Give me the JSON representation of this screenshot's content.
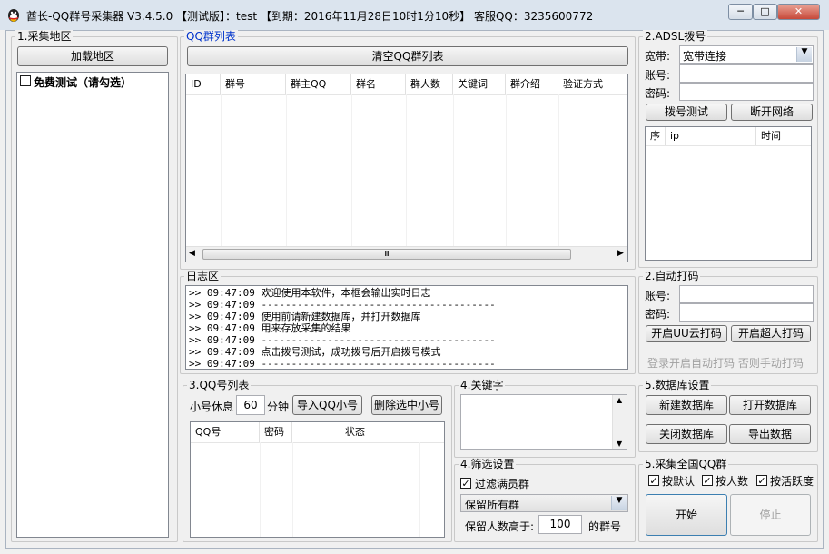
{
  "window": {
    "title": "酋长-QQ群号采集器 V3.4.5.0 【测试版】：test 【到期：2016年11月28日10时1分10秒】 客服QQ：3235600772",
    "min_label": "─",
    "max_label": "□",
    "close_label": "✕"
  },
  "region": {
    "group_label": "1.采集地区",
    "load_button": "加载地区",
    "items": [
      {
        "label": "免费测试（请勾选）",
        "checked": false
      }
    ]
  },
  "qq_groups": {
    "group_label": "QQ群列表",
    "clear_button": "清空QQ群列表",
    "columns": [
      "ID",
      "群号",
      "群主QQ",
      "群名",
      "群人数",
      "关键词",
      "群介绍",
      "验证方式"
    ],
    "scroll_thumb": "Ⅲ"
  },
  "adsl": {
    "group_label": "2.ADSL拨号",
    "broadband_label": "宽带:",
    "broadband_value": "宽带连接",
    "account_label": "账号:",
    "password_label": "密码:",
    "test_button": "拨号测试",
    "disconnect_button": "断开网络",
    "columns": [
      "序",
      "ip",
      "时间"
    ]
  },
  "log": {
    "group_label": "日志区",
    "lines": [
      ">> 09:47:09  欢迎使用本软件，本框会输出实时日志",
      ">> 09:47:09  ---------------------------------------",
      ">> 09:47:09  使用前请新建数据库，并打开数据库",
      ">> 09:47:09  用来存放采集的结果",
      ">> 09:47:09  ---------------------------------------",
      ">> 09:47:09  点击拨号测试，成功拨号后开启拨号模式",
      ">> 09:47:09  ---------------------------------------"
    ]
  },
  "captcha": {
    "group_label": "2.自动打码",
    "account_label": "账号:",
    "password_label": "密码:",
    "uu_button": "开启UU云打码",
    "super_button": "开启超人打码",
    "hint": "登录开启自动打码 否则手动打码"
  },
  "qq_accounts": {
    "group_label": "3.QQ号列表",
    "rest_label": "小号休息",
    "rest_value": "60",
    "rest_unit": "分钟",
    "import_button": "导入QQ小号",
    "delete_button": "删除选中小号",
    "columns": [
      "QQ号",
      "密码",
      "状态"
    ]
  },
  "keywords": {
    "group_label": "4.关键字"
  },
  "filter": {
    "group_label": "4.筛选设置",
    "filter_full_label": "过滤满员群",
    "filter_full_checked": true,
    "keep_value": "保留所有群",
    "min_members_label": "保留人数高于:",
    "min_members_value": "100",
    "min_members_suffix": "的群号"
  },
  "database": {
    "group_label": "5.数据库设置",
    "new_button": "新建数据库",
    "open_button": "打开数据库",
    "close_button": "关闭数据库",
    "export_button": "导出数据"
  },
  "collect": {
    "group_label": "5.采集全国QQ群",
    "options": [
      {
        "label": "按默认",
        "checked": true
      },
      {
        "label": "按人数",
        "checked": true
      },
      {
        "label": "按活跃度",
        "checked": true
      }
    ],
    "start_button": "开始",
    "stop_button": "停止"
  },
  "colors": {
    "accent_blue": "#0033cc",
    "disabled_text": "#a0a0a0",
    "close_red": "#c7493a"
  }
}
